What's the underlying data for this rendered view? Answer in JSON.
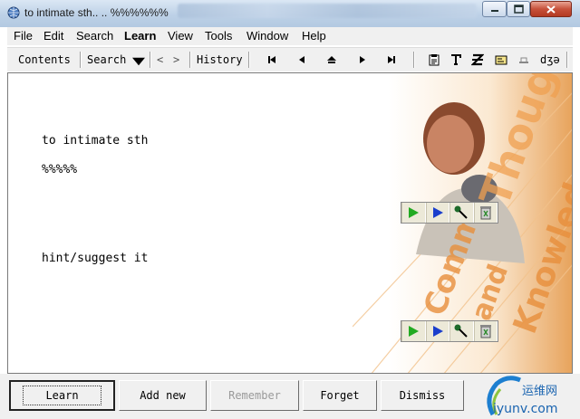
{
  "window": {
    "title": "to intimate sth.. .. %%%%%%",
    "icon": "globe-app-icon"
  },
  "menu": [
    "File",
    "Edit",
    "Search",
    "Learn",
    "View",
    "Tools",
    "Window",
    "Help"
  ],
  "menu_active": "Learn",
  "toolbar": {
    "contents_label": "Contents",
    "search_label": "Search",
    "back_label": "<",
    "forward_label": ">",
    "history_label": "History",
    "nav_icons": [
      "first-icon",
      "previous-icon",
      "up-icon",
      "next-icon",
      "last-icon"
    ],
    "tool_icons": [
      "clipboard-icon",
      "text-icon",
      "z-icon",
      "card-icon",
      "speaker-icon"
    ],
    "phonetic_label": "dʒə"
  },
  "card": {
    "question": "to intimate sth",
    "answer_line": "%%%%%",
    "hint": "hint/suggest it"
  },
  "graphic": {
    "overlay_words": [
      "Thought",
      "Comm",
      "and",
      "Knowled"
    ]
  },
  "buttons": {
    "learn": "Learn",
    "add_new": "Add new",
    "remember": "Remember",
    "forget": "Forget",
    "dismiss": "Dismiss"
  },
  "watermark": {
    "cn_text": "运维网",
    "url_text": "iyunv.com"
  },
  "colors": {
    "accent_orange": "#f0a050",
    "play_green": "#22aa22",
    "play_blue": "#1a3ecc",
    "close_red": "#c7513a"
  }
}
